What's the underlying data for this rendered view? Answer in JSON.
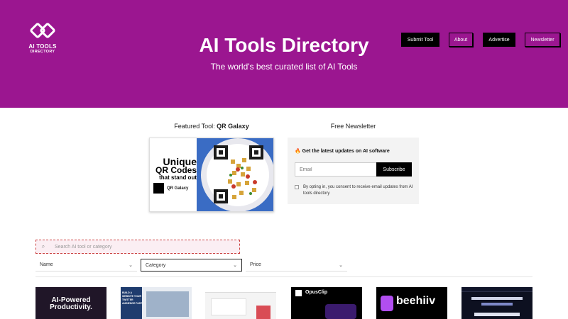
{
  "logo": {
    "line1": "AI TOOLS",
    "line2": "DIRECTORY"
  },
  "nav": [
    "Submit Tool",
    "About",
    "Advertise",
    "Newsletter"
  ],
  "hero": {
    "title": "AI Tools Directory",
    "subtitle": "The world's best curated list of AI Tools"
  },
  "featured": {
    "label_prefix": "Featured Tool:",
    "label_tool": "QR Galaxy",
    "ad_line1": "Unique",
    "ad_line2": "QR Codes",
    "ad_line3": "that stand out",
    "ad_brand": "QR Galaxy"
  },
  "newsletter": {
    "label": "Free Newsletter",
    "headline": "Get the latest updates on AI software",
    "email_placeholder": "Email",
    "subscribe": "Subscribe",
    "consent": "By opting in, you consent to receive email updates from AI tools directory"
  },
  "search": {
    "placeholder": "Search AI tool or category"
  },
  "filters": [
    "Name",
    "Category",
    "Price"
  ],
  "thumbnails": [
    {
      "text": "AI-Powered Productivity."
    },
    {
      "text": "BUILD A WEBSITE YOUR TWITTER AUDIENCE FAST."
    },
    {
      "text": ""
    },
    {
      "text": "OpusClip"
    },
    {
      "text": "beehiiv"
    },
    {
      "text": ""
    }
  ],
  "colors": {
    "brand": "#9b1690",
    "dark": "#000000"
  }
}
